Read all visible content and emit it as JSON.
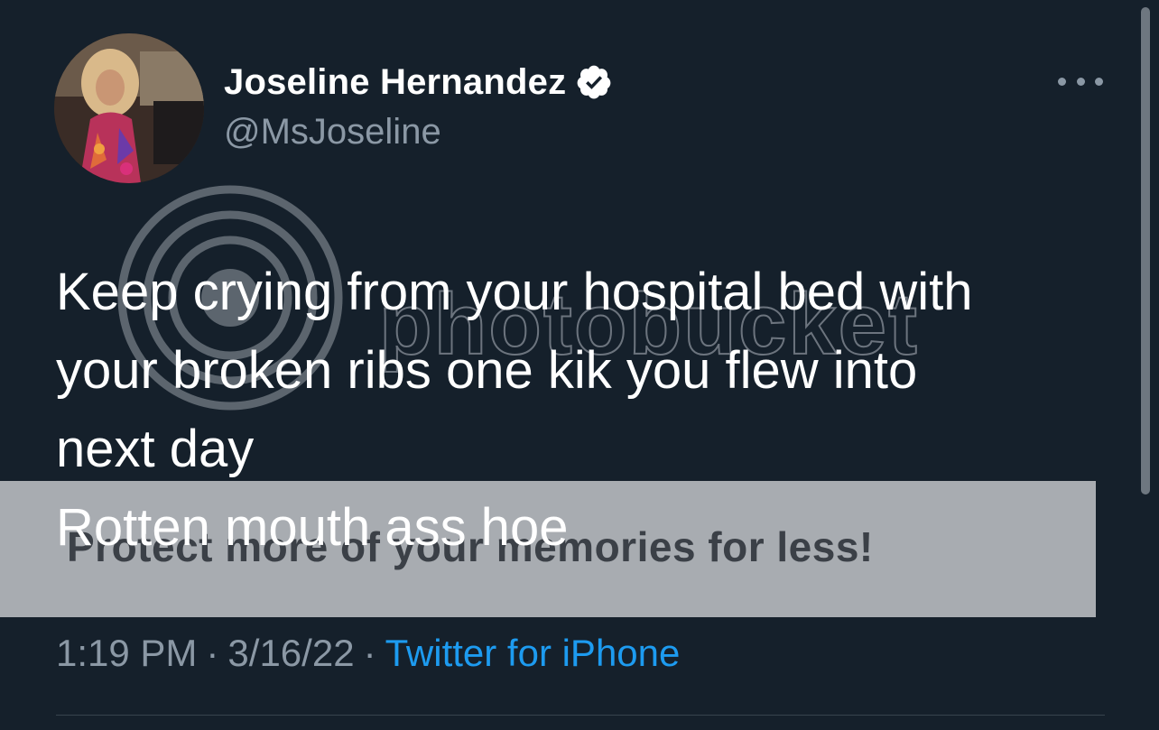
{
  "author": {
    "display_name": "Joseline Hernandez",
    "handle": "@MsJoseline",
    "verified": true,
    "avatar_icon": "profile-photo"
  },
  "menu": {
    "icon": "more-horizontal-icon"
  },
  "tweet": {
    "lines": [
      "Keep crying from your hospital bed with",
      "your broken ribs one kik you flew into",
      "next day",
      "Rotten mouth ass hoe"
    ]
  },
  "meta": {
    "time": "1:19 PM",
    "separator": "·",
    "date": "3/16/22",
    "source": "Twitter for iPhone"
  },
  "watermark": {
    "brand": "photobucket",
    "banner": "Protect more of your memories for less!"
  },
  "colors": {
    "background": "#15202b",
    "text": "#ffffff",
    "secondary_text": "#8b98a5",
    "link": "#1d9bf0",
    "verified_badge": "#ffffff"
  }
}
